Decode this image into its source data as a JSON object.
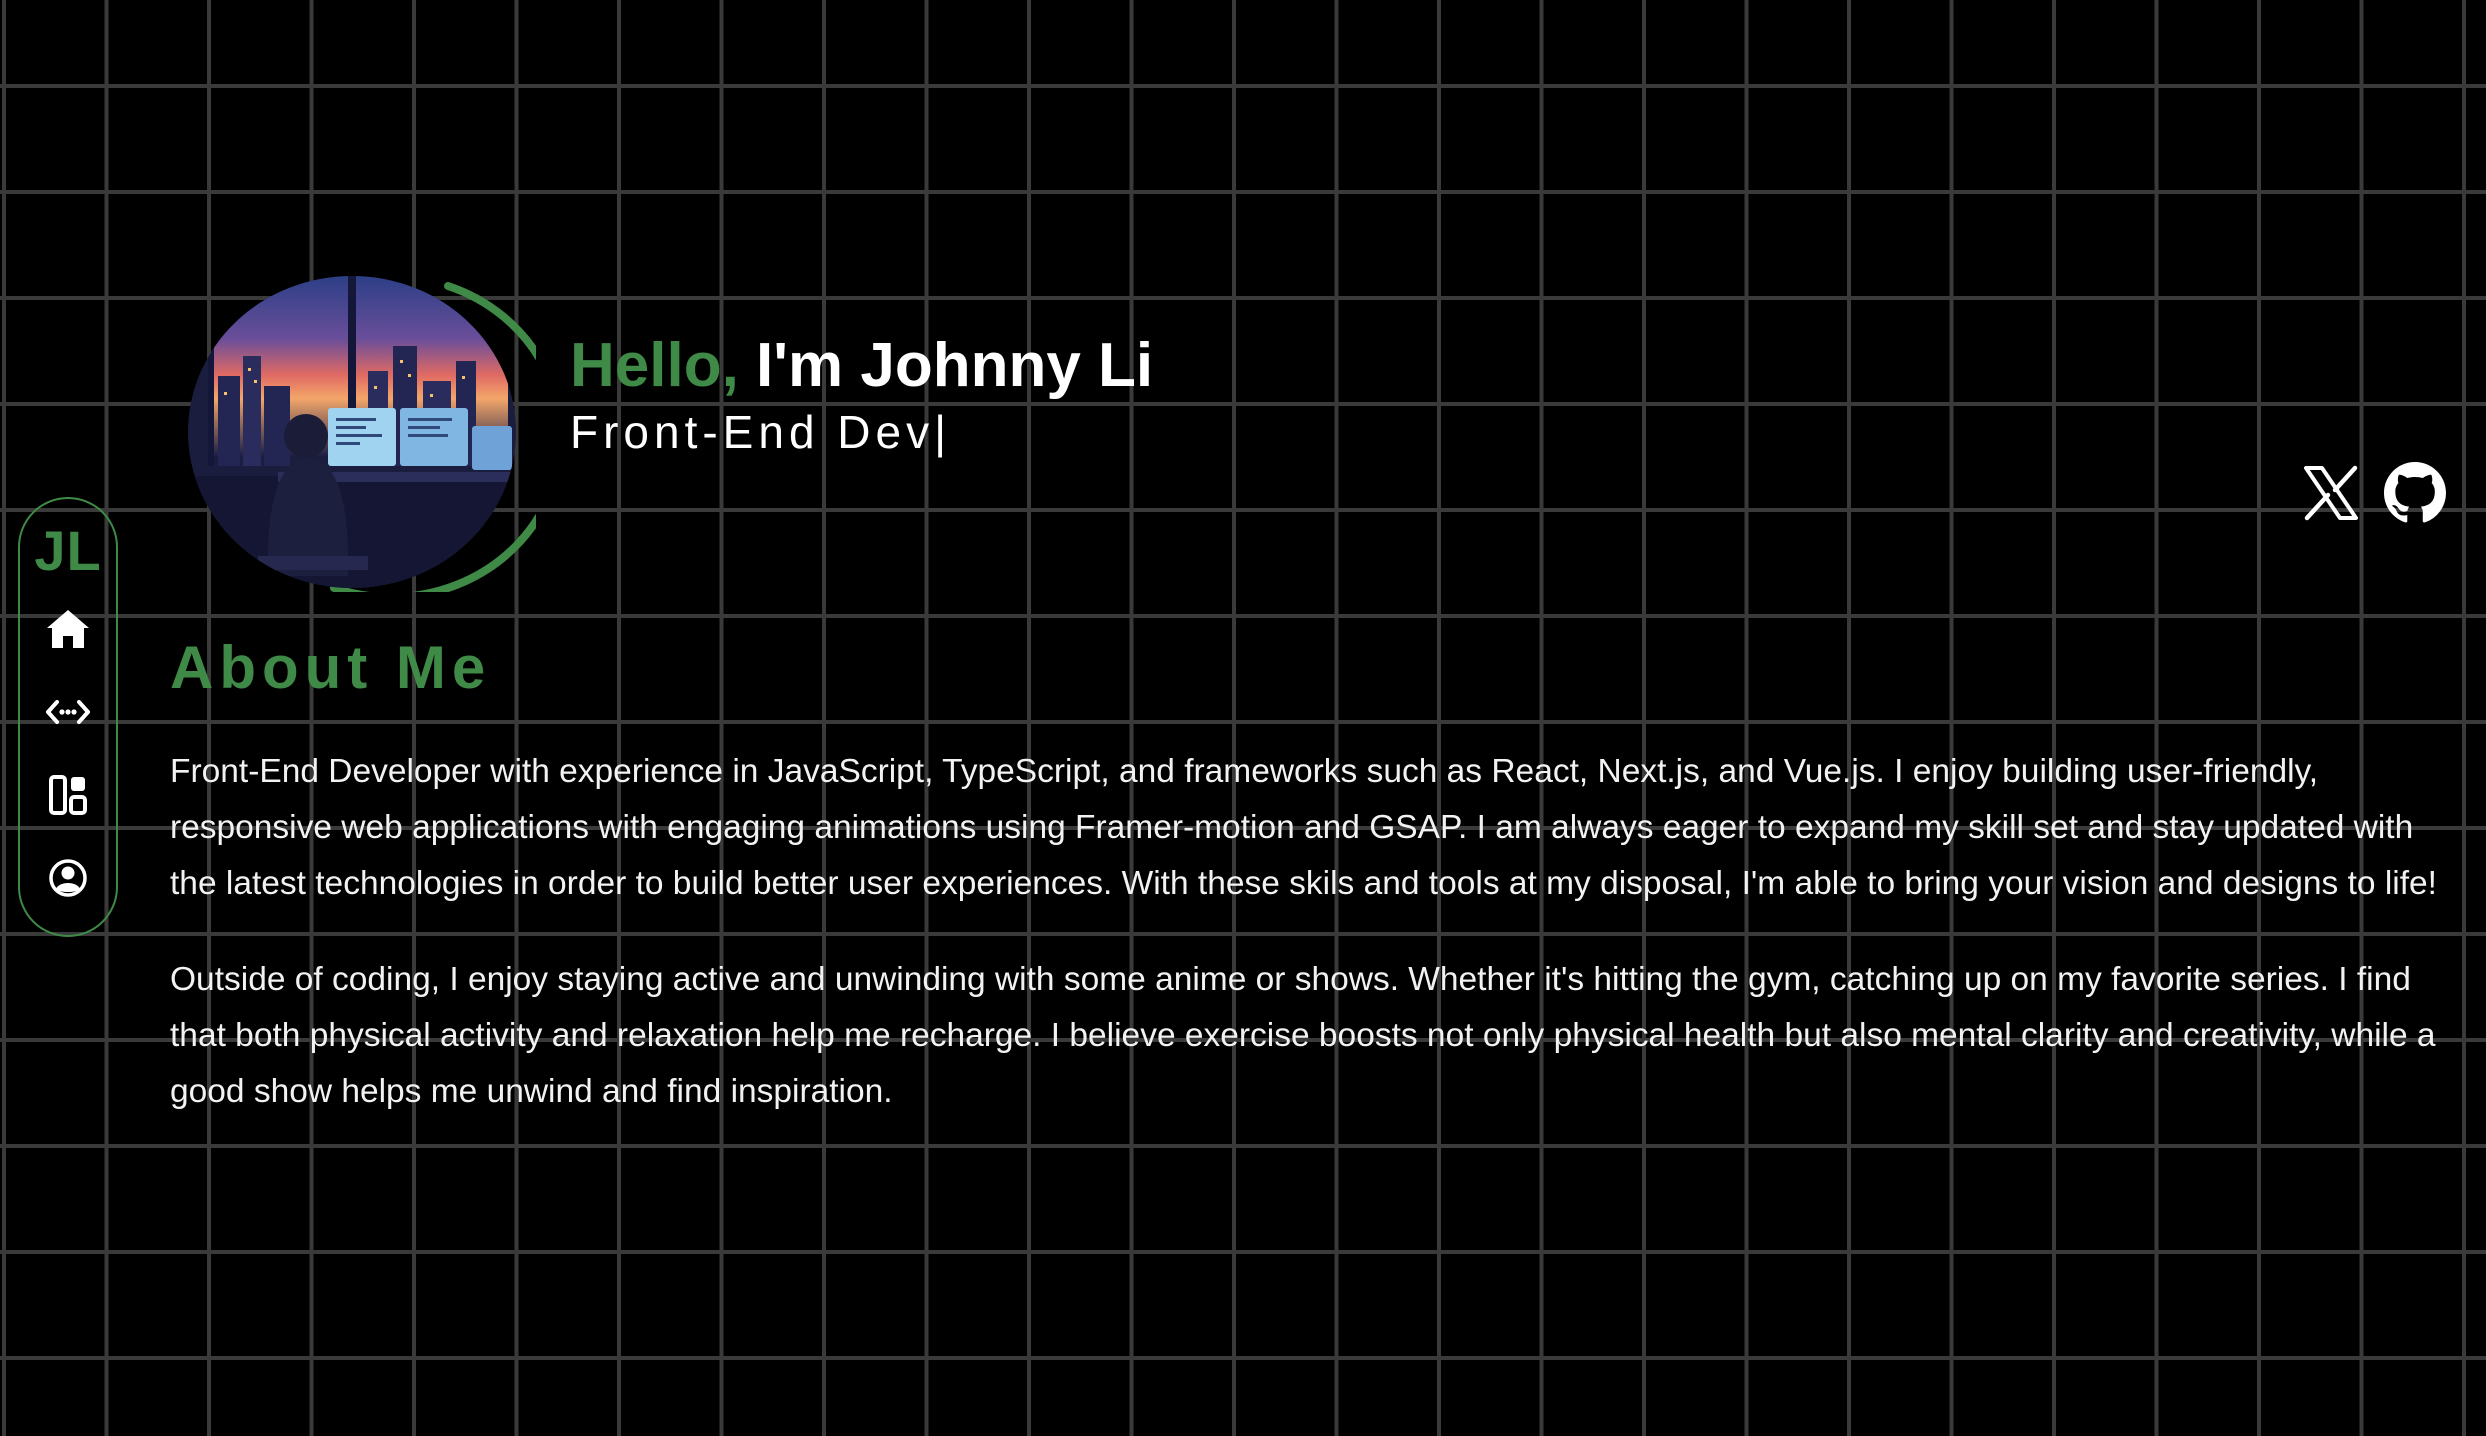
{
  "nav": {
    "logo": "JL",
    "items": [
      {
        "icon": "home-icon",
        "target": "home"
      },
      {
        "icon": "code-icon",
        "target": "skills"
      },
      {
        "icon": "projects-icon",
        "target": "projects"
      },
      {
        "icon": "user-icon",
        "target": "about"
      }
    ]
  },
  "hero": {
    "greeting": "Hello,",
    "name": "I'm Johnny Li",
    "role": "Front-End Dev",
    "caret": "|",
    "avatar_alt": "pixel-art developer at desk at night"
  },
  "socials": [
    {
      "icon": "x-icon"
    },
    {
      "icon": "github-icon"
    }
  ],
  "about": {
    "title": "About Me",
    "paragraphs": [
      "Front-End Developer with experience in JavaScript, TypeScript, and frameworks such as React, Next.js, and Vue.js. I enjoy building user-friendly, responsive web applications with engaging animations using Framer-motion and GSAP. I am always eager to expand my skill set and stay updated with the latest technologies in order to build better user experiences. With these skils and tools at my disposal, I'm able to bring your vision and designs to life!",
      "Outside of coding, I enjoy staying active and unwinding with some anime or shows. Whether it's hitting the gym, catching up on my favorite series. I find that both physical activity and relaxation help me recharge. I believe exercise boosts not only physical health but also mental clarity and creativity, while a good show helps me unwind and find inspiration."
    ]
  },
  "colors": {
    "accent": "#3f8a46",
    "background": "#000000",
    "grid": "#3a3a3a",
    "text": "#ffffff"
  }
}
